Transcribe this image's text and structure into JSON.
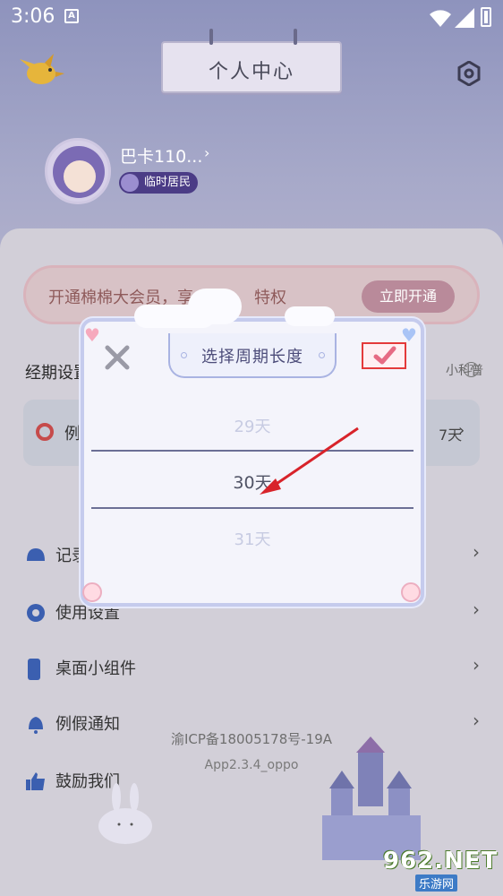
{
  "status_bar": {
    "time": "3:06",
    "a_icon": "A"
  },
  "header": {
    "title": "个人中心"
  },
  "profile": {
    "username": "巴卡110...",
    "badge": "临时居民"
  },
  "vip": {
    "text": "开通棉棉大会员，享",
    "text_tail": "特权",
    "button": "立即开通"
  },
  "section": {
    "title": "经期设置",
    "science_link": "小科普",
    "help": "?"
  },
  "period": {
    "label": "例",
    "value": "7天"
  },
  "menu": [
    {
      "label": "记录",
      "icon": "bell-icon"
    },
    {
      "label": "使用设置",
      "icon": "gear-icon"
    },
    {
      "label": "桌面小组件",
      "icon": "phone-icon"
    },
    {
      "label": "例假通知",
      "icon": "notification-icon"
    },
    {
      "label": "鼓励我们",
      "icon": "thumbs-up-icon"
    }
  ],
  "footer": {
    "icp": "渝ICP备18005178号-19A",
    "version": "App2.3.4_oppo"
  },
  "dialog": {
    "title": "选择周期长度",
    "options": [
      "29天",
      "30天",
      "31天"
    ],
    "selected": "30天"
  },
  "watermark": {
    "logo": "962.NET",
    "sub": "乐游网"
  },
  "colors": {
    "accent": "#e43a3a",
    "dialog_border": "#c5cbed"
  }
}
